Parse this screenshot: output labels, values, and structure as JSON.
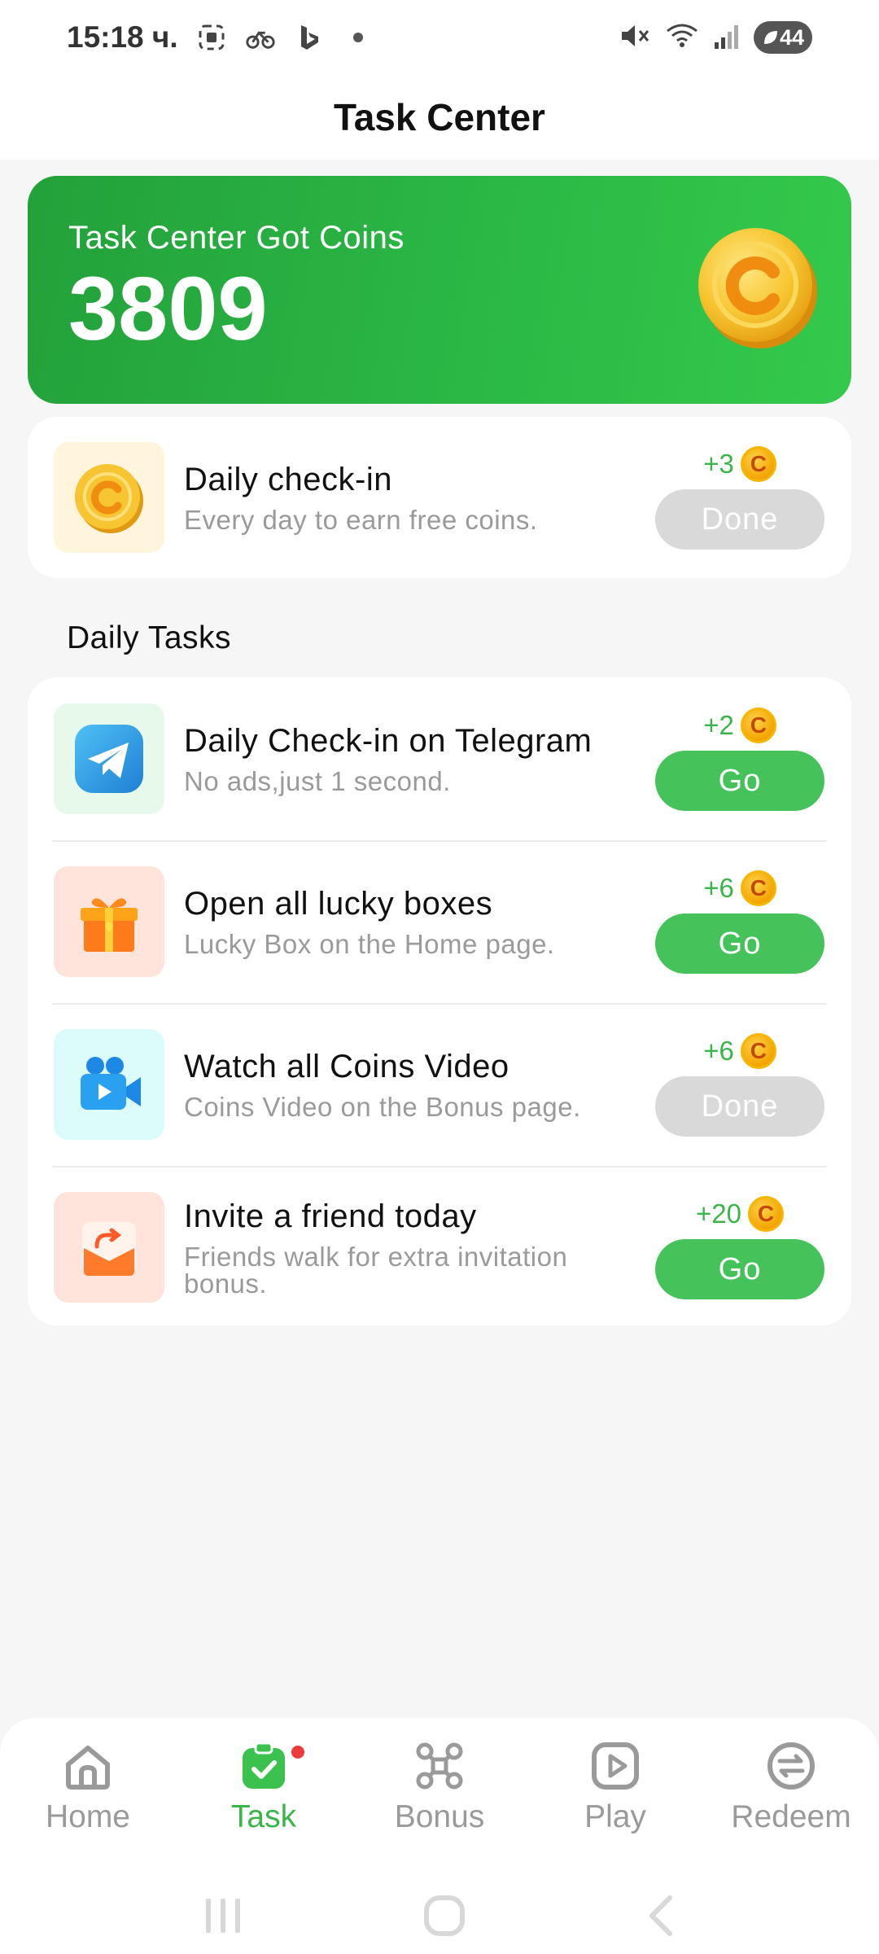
{
  "status_bar": {
    "time": "15:18 ч.",
    "battery": "44"
  },
  "header": {
    "title": "Task Center"
  },
  "coins": {
    "label": "Task Center Got Coins",
    "value": "3809"
  },
  "daily_checkin": {
    "title": "Daily check-in",
    "subtitle": "Every day to earn free coins.",
    "reward": "+3",
    "button": "Done"
  },
  "daily_tasks": {
    "section_title": "Daily Tasks",
    "items": [
      {
        "title": "Daily Check-in on Telegram",
        "subtitle": "No ads,just 1 second.",
        "reward": "+2",
        "button": "Go",
        "icon": "telegram-icon"
      },
      {
        "title": "Open all lucky boxes",
        "subtitle": "Lucky Box on the Home page.",
        "reward": "+6",
        "button": "Go",
        "icon": "gift-icon"
      },
      {
        "title": "Watch all Coins Video",
        "subtitle": "Coins Video on the Bonus page.",
        "reward": "+6",
        "button": "Done",
        "icon": "video-camera-icon"
      },
      {
        "title": "Invite a friend today",
        "subtitle": "Friends walk for extra invitation bonus.",
        "reward": "+20",
        "button": "Go",
        "icon": "invite-envelope-icon"
      }
    ]
  },
  "bottom_nav": {
    "items": [
      {
        "label": "Home",
        "icon": "home-icon"
      },
      {
        "label": "Task",
        "icon": "task-clipboard-icon"
      },
      {
        "label": "Bonus",
        "icon": "bonus-network-icon"
      },
      {
        "label": "Play",
        "icon": "play-icon"
      },
      {
        "label": "Redeem",
        "icon": "redeem-exchange-icon"
      }
    ],
    "active": "Task"
  },
  "colors": {
    "accent_green": "#45c35a",
    "banner_green": "#2bb845",
    "done_gray": "#d9d9d9",
    "coin_gold": "#f3a500"
  }
}
